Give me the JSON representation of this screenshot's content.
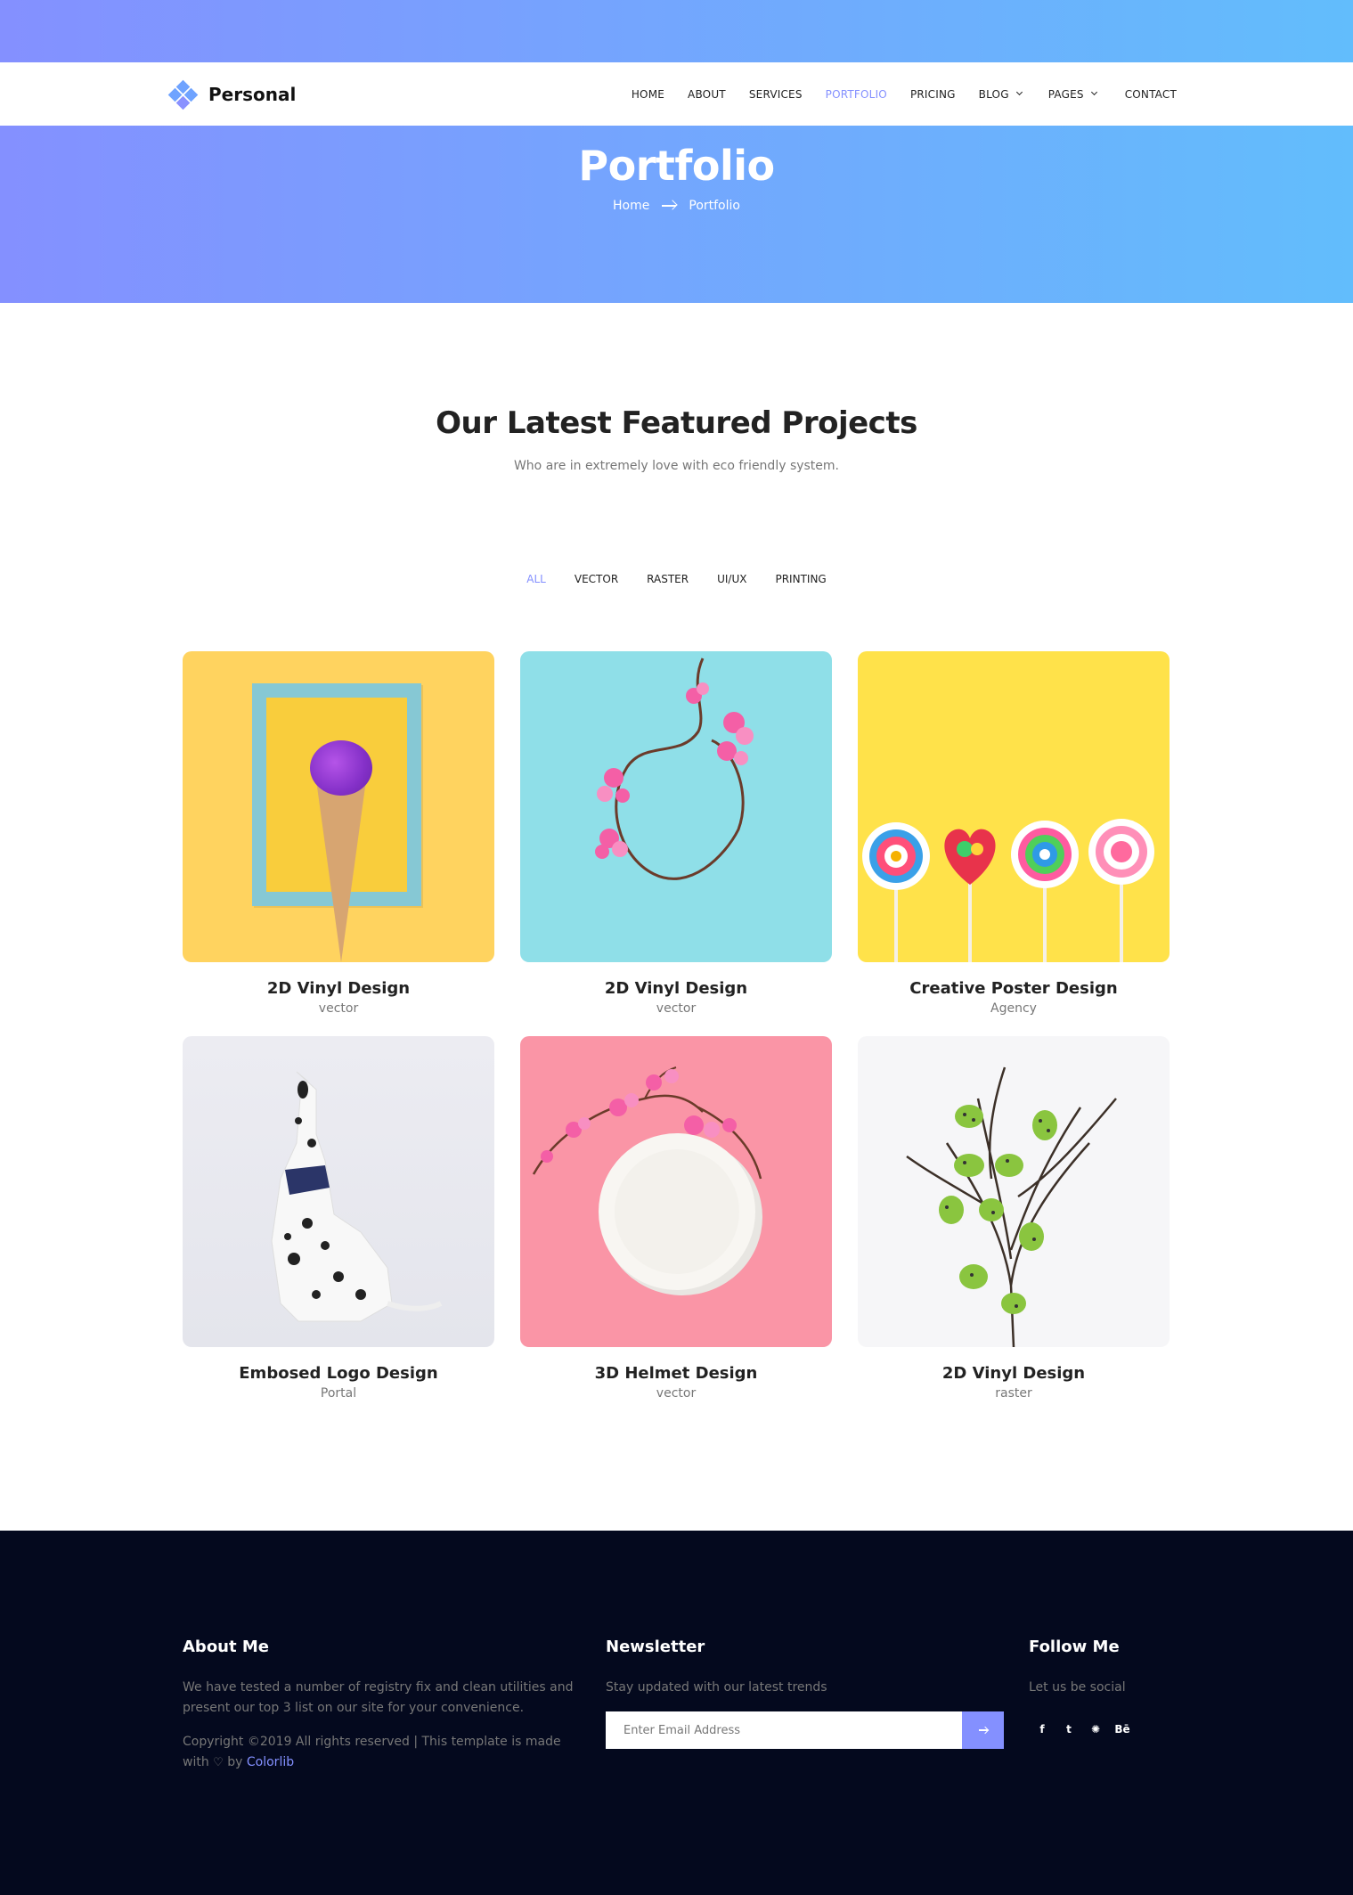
{
  "colors": {
    "accent": "#8490ff",
    "gradient_start": "#8490ff",
    "gradient_end": "#62bdfc",
    "footer_bg": "#04091e"
  },
  "brand": {
    "name": "Personal"
  },
  "nav": {
    "items": [
      {
        "label": "HOME"
      },
      {
        "label": "ABOUT"
      },
      {
        "label": "SERVICES"
      },
      {
        "label": "PORTFOLIO"
      },
      {
        "label": "PRICING"
      },
      {
        "label": "BLOG"
      },
      {
        "label": "PAGES"
      },
      {
        "label": "CONTACT"
      }
    ],
    "active": "PORTFOLIO"
  },
  "banner": {
    "title": "Portfolio",
    "breadcrumb": [
      "Home",
      "Portfolio"
    ]
  },
  "section": {
    "title": "Our Latest Featured Projects",
    "subtitle": "Who are in extremely love with eco friendly system."
  },
  "filters": [
    "ALL",
    "VECTOR",
    "RASTER",
    "UI/UX",
    "PRINTING"
  ],
  "projects": [
    {
      "title": "2D Vinyl Design",
      "category": "vector"
    },
    {
      "title": "2D Vinyl Design",
      "category": "vector"
    },
    {
      "title": "Creative Poster Design",
      "category": "Agency"
    },
    {
      "title": "Embosed Logo Design",
      "category": "Portal"
    },
    {
      "title": "3D Helmet Design",
      "category": "vector"
    },
    {
      "title": "2D Vinyl Design",
      "category": "raster"
    }
  ],
  "footer": {
    "about": {
      "title": "About Me",
      "text": "We have tested a number of registry fix and clean utilities and present our top 3 list on our site for your convenience.",
      "copyright": "Copyright ©2019 All rights reserved | This template is made with",
      "by": "by",
      "link": "Colorlib"
    },
    "newsletter": {
      "title": "Newsletter",
      "text": "Stay updated with our latest trends",
      "placeholder": "Enter Email Address"
    },
    "follow": {
      "title": "Follow Me",
      "text": "Let us be social",
      "socials": [
        "f",
        "t",
        "✺",
        "Bē"
      ],
      "icons": [
        "facebook-icon",
        "twitter-icon",
        "dribbble-icon",
        "behance-icon"
      ]
    }
  }
}
